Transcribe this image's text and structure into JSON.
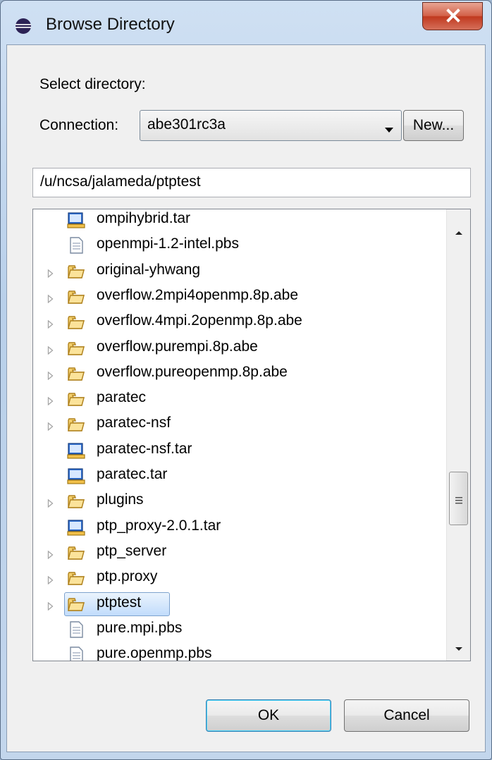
{
  "window": {
    "title": "Browse Directory"
  },
  "dialog": {
    "select_label": "Select directory:",
    "connection_label": "Connection:",
    "connection_value": "abe301rc3a",
    "new_button": "New...",
    "path": "/u/ncsa/jalameda/ptptest"
  },
  "tree": {
    "items": [
      {
        "label": "ompihybrid.tar",
        "type": "archive",
        "expandable": false
      },
      {
        "label": "openmpi-1.2-intel.pbs",
        "type": "file",
        "expandable": false
      },
      {
        "label": "original-yhwang",
        "type": "folder",
        "expandable": true
      },
      {
        "label": "overflow.2mpi4openmp.8p.abe",
        "type": "folder",
        "expandable": true
      },
      {
        "label": "overflow.4mpi.2openmp.8p.abe",
        "type": "folder",
        "expandable": true
      },
      {
        "label": "overflow.purempi.8p.abe",
        "type": "folder",
        "expandable": true
      },
      {
        "label": "overflow.pureopenmp.8p.abe",
        "type": "folder",
        "expandable": true
      },
      {
        "label": "paratec",
        "type": "folder",
        "expandable": true
      },
      {
        "label": "paratec-nsf",
        "type": "folder",
        "expandable": true
      },
      {
        "label": "paratec-nsf.tar",
        "type": "archive",
        "expandable": false
      },
      {
        "label": "paratec.tar",
        "type": "archive",
        "expandable": false
      },
      {
        "label": "plugins",
        "type": "folder",
        "expandable": true
      },
      {
        "label": "ptp_proxy-2.0.1.tar",
        "type": "archive",
        "expandable": false
      },
      {
        "label": "ptp_server",
        "type": "folder",
        "expandable": true
      },
      {
        "label": "ptp.proxy",
        "type": "folder",
        "expandable": true
      },
      {
        "label": "ptptest",
        "type": "folder",
        "expandable": true,
        "selected": true
      },
      {
        "label": "pure.mpi.pbs",
        "type": "file",
        "expandable": false
      },
      {
        "label": "pure.openmp.pbs",
        "type": "file",
        "expandable": false
      }
    ]
  },
  "buttons": {
    "ok": "OK",
    "cancel": "Cancel"
  },
  "colors": {
    "selection": "#c1dcfc",
    "folder": "#e8b64a",
    "close": "#c7432a"
  }
}
